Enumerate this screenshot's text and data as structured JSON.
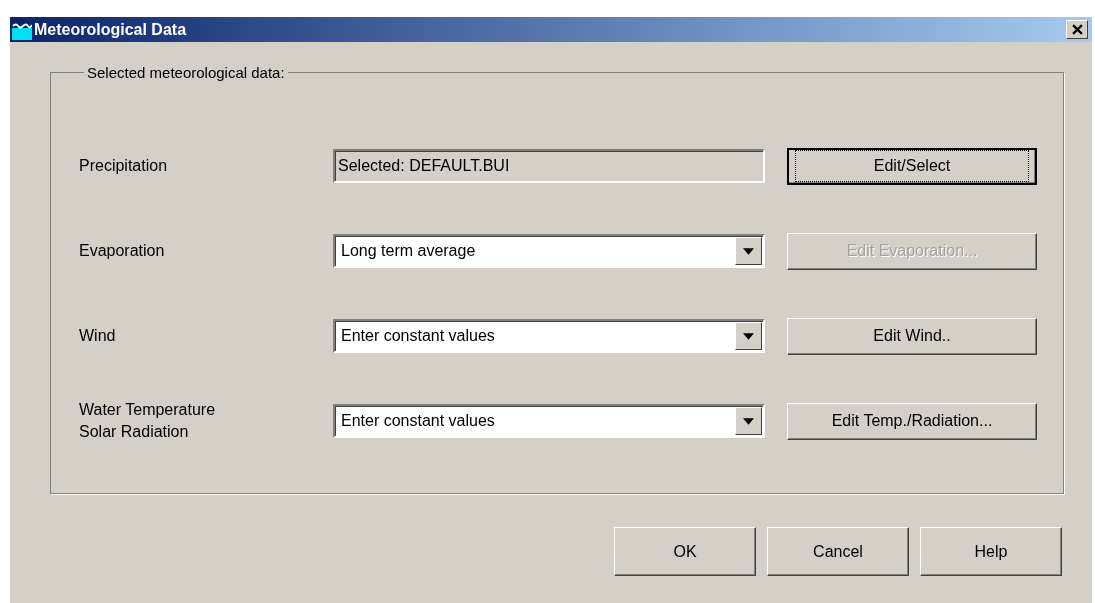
{
  "window": {
    "title": "Meteorological Data"
  },
  "group": {
    "label": "Selected meteorological data:"
  },
  "rows": [
    {
      "label": "Precipitation",
      "field": {
        "kind": "readonly",
        "value": "Selected: DEFAULT.BUI"
      },
      "button": {
        "label": "Edit/Select",
        "disabled": false,
        "focused": true
      }
    },
    {
      "label": "Evaporation",
      "field": {
        "kind": "dropdown",
        "value": "Long term average"
      },
      "button": {
        "label": "Edit Evaporation...",
        "disabled": true,
        "focused": false
      }
    },
    {
      "label": "Wind",
      "field": {
        "kind": "dropdown",
        "value": "Enter constant values"
      },
      "button": {
        "label": "Edit Wind..",
        "disabled": false,
        "focused": false
      }
    },
    {
      "label": "Water Temperature\nSolar Radiation",
      "field": {
        "kind": "dropdown",
        "value": "Enter constant values"
      },
      "button": {
        "label": "Edit Temp./Radiation...",
        "disabled": false,
        "focused": false
      }
    }
  ],
  "buttons": [
    {
      "label": "OK"
    },
    {
      "label": "Cancel"
    },
    {
      "label": "Help"
    }
  ]
}
